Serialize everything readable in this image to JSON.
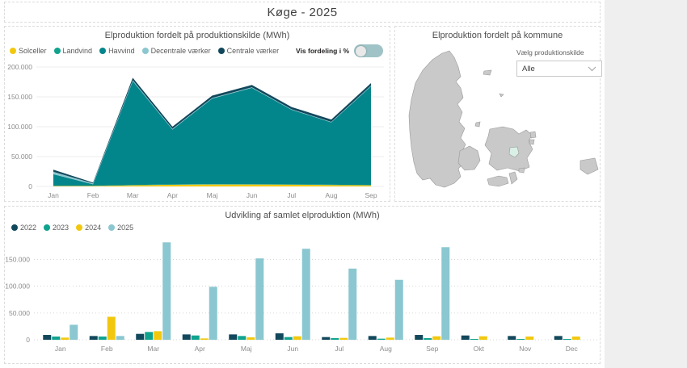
{
  "page": {
    "title": "Køge - 2025"
  },
  "source_chart": {
    "title": "Elproduktion fordelt på produktionskilde (MWh)",
    "toggle_label": "Vis fordeling i %",
    "toggle_state": "off",
    "toggle_track_color": "#9fc3c6",
    "toggle_knob_color": "#e9e9e9"
  },
  "map_panel": {
    "title": "Elproduktion fordelt på kommune",
    "dropdown_label": "Vælg produktionskilde",
    "dropdown_value": "Alle",
    "land_color": "#c9c9c9",
    "border_color": "#9a9a9a",
    "highlight_color": "#d9f0e7"
  },
  "trend_chart": {
    "title": "Udvikling af samlet elproduktion (MWh)"
  },
  "chart_data": [
    {
      "type": "area",
      "stacked": true,
      "title": "Elproduktion fordelt på produktionskilde (MWh)",
      "categories": [
        "Jan",
        "Feb",
        "Mar",
        "Apr",
        "Maj",
        "Jun",
        "Jul",
        "Aug",
        "Sep"
      ],
      "series": [
        {
          "name": "Solceller",
          "color": "#f2c80f",
          "values": [
            600,
            800,
            1800,
            2800,
            3200,
            3200,
            3000,
            2400,
            1800
          ]
        },
        {
          "name": "Landvind",
          "color": "#0fa38f",
          "values": [
            400,
            300,
            500,
            500,
            500,
            400,
            400,
            400,
            400
          ]
        },
        {
          "name": "Havvind",
          "color": "#03868b",
          "values": [
            19500,
            2400,
            174000,
            92000,
            143500,
            161500,
            125000,
            104500,
            165500
          ]
        },
        {
          "name": "Decentrale værker",
          "color": "#8bc7d0",
          "values": [
            4000,
            1500,
            1500,
            1200,
            1000,
            1000,
            800,
            800,
            1000
          ]
        },
        {
          "name": "Centrale værker",
          "color": "#12485c",
          "values": [
            3500,
            1500,
            4200,
            3500,
            3800,
            3900,
            3800,
            3900,
            4300
          ]
        }
      ],
      "ylim": [
        0,
        200000
      ],
      "yticks": [
        "0",
        "50.000",
        "100.000",
        "150.000",
        "200.000"
      ],
      "grid": true,
      "legend_position": "top-left"
    },
    {
      "type": "bar",
      "title": "Udvikling af samlet elproduktion (MWh)",
      "categories": [
        "Jan",
        "Feb",
        "Mar",
        "Apr",
        "Maj",
        "Jun",
        "Jul",
        "Aug",
        "Sep",
        "Okt",
        "Nov",
        "Dec"
      ],
      "series": [
        {
          "name": "2022",
          "color": "#12485c",
          "values": [
            9000,
            7000,
            11000,
            10000,
            10000,
            12000,
            5000,
            7000,
            9000,
            8000,
            7000,
            7000
          ]
        },
        {
          "name": "2023",
          "color": "#0fa38f",
          "values": [
            6000,
            6000,
            14500,
            8000,
            7000,
            5000,
            3000,
            2000,
            3000,
            1500,
            1500,
            1500
          ]
        },
        {
          "name": "2024",
          "color": "#f2c80f",
          "values": [
            4000,
            43000,
            16000,
            2500,
            4500,
            6500,
            3500,
            4000,
            6500,
            6500,
            6000,
            6000
          ]
        },
        {
          "name": "2025",
          "color": "#8bc7d0",
          "values": [
            28000,
            7000,
            182000,
            99000,
            152000,
            170000,
            133000,
            112000,
            173000,
            null,
            null,
            null
          ]
        }
      ],
      "ylim": [
        0,
        190000
      ],
      "yticks": [
        "0",
        "50.000",
        "100.000",
        "150.000"
      ],
      "grid": "dotted",
      "legend_position": "top-left"
    }
  ]
}
